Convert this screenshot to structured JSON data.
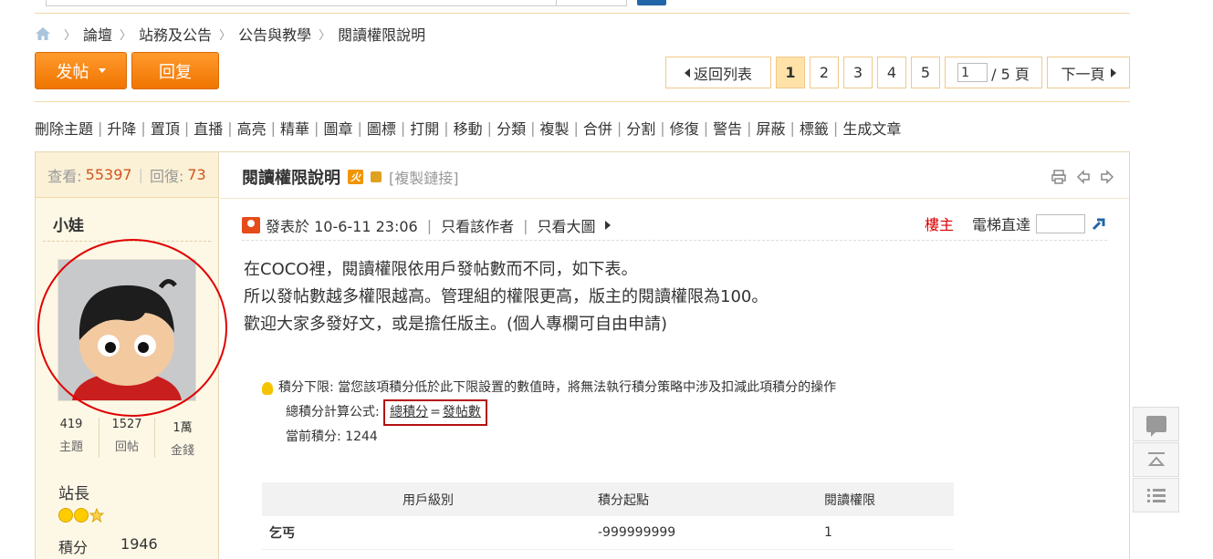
{
  "breadcrumb": {
    "items": [
      "論壇",
      "站務及公告",
      "公告與教學",
      "閱讀權限說明"
    ]
  },
  "actions": {
    "post": "发帖",
    "reply": "回复"
  },
  "pager": {
    "back": "返回列表",
    "pages": [
      "1",
      "2",
      "3",
      "4",
      "5"
    ],
    "current": "1",
    "input_value": "1",
    "total": "/ 5 頁",
    "next": "下一頁"
  },
  "modtools": [
    "刪除主題",
    "升降",
    "置頂",
    "直播",
    "高亮",
    "精華",
    "圖章",
    "圖標",
    "打開",
    "移動",
    "分類",
    "複製",
    "合併",
    "分割",
    "修復",
    "警告",
    "屏蔽",
    "標籤",
    "生成文章"
  ],
  "user": {
    "views_label": "查看:",
    "views": "55397",
    "replies_label": "回復:",
    "replies": "73",
    "name": "小娃",
    "counts": [
      {
        "n": "419",
        "l": "主題"
      },
      {
        "n": "1527",
        "l": "回帖"
      },
      {
        "n": "1萬",
        "l": "金錢"
      }
    ],
    "rank": "站長",
    "points_label": "積分",
    "points": "1946"
  },
  "thread": {
    "title": "閱讀權限說明",
    "hot": "火",
    "copy": "[複製鏈接]"
  },
  "meta": {
    "posted": "發表於 10-6-11 23:06",
    "only_author": "只看該作者",
    "only_img": "只看大圖",
    "host": "樓主",
    "elevator": "電梯直達"
  },
  "body": [
    "在COCO裡，閱讀權限依用戶發帖數而不同，如下表。",
    "所以發帖數越多權限越高。管理組的權限更高，版主的閱讀權限為100。",
    "歡迎大家多發好文，或是擔任版主。(個人專欄可自由申請)"
  ],
  "points_panel": {
    "lower_limit": "積分下限: 當您該項積分低於此下限設置的數值時，將無法執行積分策略中涉及扣減此項積分的操作",
    "formula_label": "總積分計算公式:",
    "formula_a": "總積分",
    "formula_eq": "=",
    "formula_b": "發帖數",
    "current": "當前積分: 1244"
  },
  "table": {
    "headers": [
      "用戶級別",
      "積分起點",
      "閱讀權限"
    ],
    "rows": [
      [
        "乞丐",
        "-999999999",
        "1"
      ]
    ]
  },
  "colors": {
    "accent": "#f07500",
    "link_blue": "#2366a8",
    "host_red": "#dd0000"
  }
}
